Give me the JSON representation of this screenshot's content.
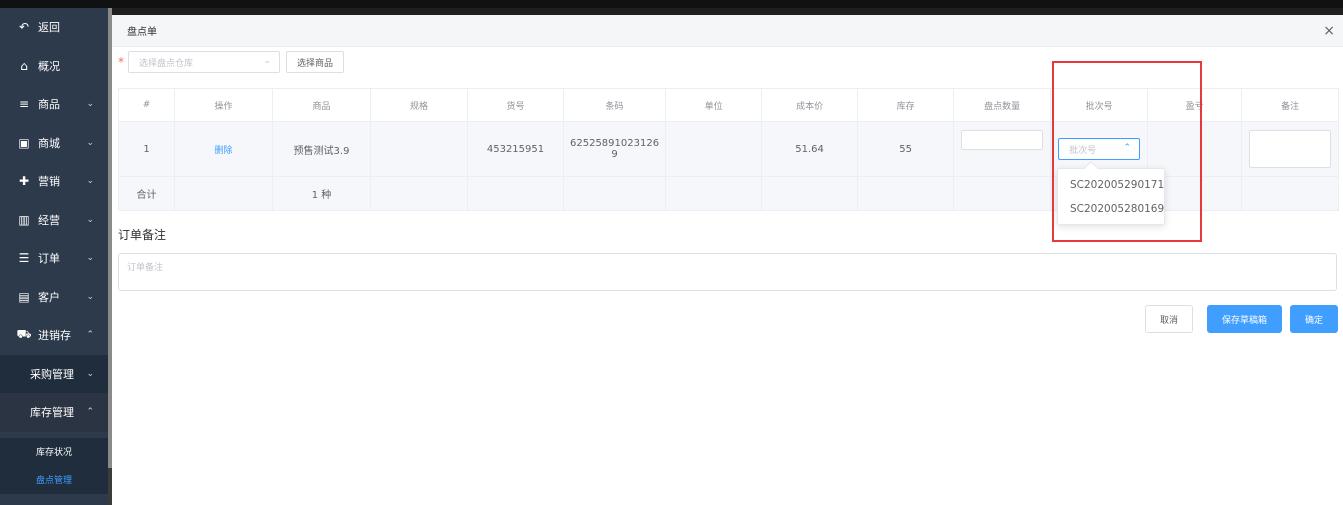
{
  "sidebar": {
    "items": [
      {
        "label": "返回",
        "icon": "back-arrow-icon",
        "glyph": "↶",
        "chevron": ""
      },
      {
        "label": "概况",
        "icon": "home-icon",
        "glyph": "⌂",
        "chevron": ""
      },
      {
        "label": "商品",
        "icon": "list-icon",
        "glyph": "≡",
        "chevron": "⌄"
      },
      {
        "label": "商城",
        "icon": "shopping-bag-icon",
        "glyph": "▣",
        "chevron": "⌄"
      },
      {
        "label": "营销",
        "icon": "gift-icon",
        "glyph": "✚",
        "chevron": "⌄"
      },
      {
        "label": "经营",
        "icon": "bar-chart-icon",
        "glyph": "▥",
        "chevron": "⌄"
      },
      {
        "label": "订单",
        "icon": "order-list-icon",
        "glyph": "☰",
        "chevron": "⌄"
      },
      {
        "label": "客户",
        "icon": "id-card-icon",
        "glyph": "▤",
        "chevron": "⌄"
      },
      {
        "label": "进销存",
        "icon": "truck-icon",
        "glyph": "⛟",
        "chevron": "⌃"
      }
    ],
    "sub": [
      {
        "label": "采购管理",
        "chevron": "⌄"
      },
      {
        "label": "库存管理",
        "chevron": "⌃"
      }
    ],
    "leaves": [
      "库存状况",
      "盘点管理"
    ]
  },
  "modal": {
    "title": "盘点单",
    "close": "×",
    "required_mark": "*",
    "warehouse_placeholder": "选择盘点仓库",
    "select_product_btn": "选择商品"
  },
  "table": {
    "headers": [
      "#",
      "操作",
      "商品",
      "规格",
      "货号",
      "条码",
      "单位",
      "成本价",
      "库存",
      "盘点数量",
      "批次号",
      "盈亏",
      "备注"
    ],
    "row": {
      "index": "1",
      "action": "删除",
      "product": "预售测试3.9",
      "spec": "",
      "sku": "453215951",
      "barcode": "62525891023126 9",
      "unit": "",
      "cost": "51.64",
      "stock": "55",
      "batch_placeholder": "批次号"
    },
    "summary": {
      "label": "合计",
      "count": "1 种"
    }
  },
  "dropdown": {
    "options": [
      "SC202005290171",
      "SC202005280169"
    ]
  },
  "remark": {
    "title": "订单备注",
    "placeholder": "订单备注"
  },
  "buttons": {
    "cancel": "取消",
    "save_draft": "保存草稿箱",
    "confirm": "确定"
  },
  "colors": {
    "primary": "#409eff",
    "sidebar_bg": "#2d3a4b",
    "highlight": "#e8393a"
  }
}
